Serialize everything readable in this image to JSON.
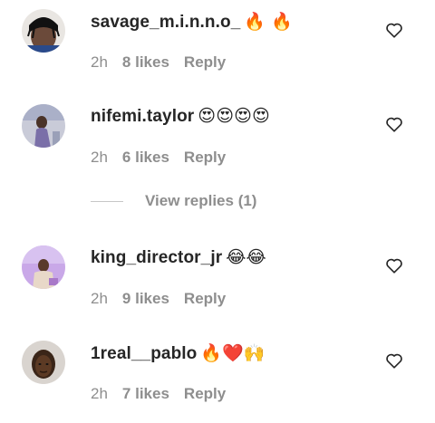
{
  "comments": [
    {
      "username": "savage_m.i.n.n.o_",
      "emoji": "🔥 🔥",
      "time": "2h",
      "likes": "8 likes",
      "reply": "Reply"
    },
    {
      "username": "nifemi.taylor",
      "emoji": "😍😍😍😍",
      "time": "2h",
      "likes": "6 likes",
      "reply": "Reply"
    },
    {
      "username": "king_director_jr",
      "emoji": "😂😂",
      "time": "2h",
      "likes": "9 likes",
      "reply": "Reply"
    },
    {
      "username": "1real__pablo",
      "emoji": "🔥❤️🙌",
      "time": "2h",
      "likes": "7 likes",
      "reply": "Reply"
    }
  ],
  "view_replies": "View replies (1)",
  "icons": {
    "like": "heart-outline-icon"
  },
  "colors": {
    "username": "#262626",
    "secondary": "#8e8e8e",
    "background": "#ffffff"
  }
}
